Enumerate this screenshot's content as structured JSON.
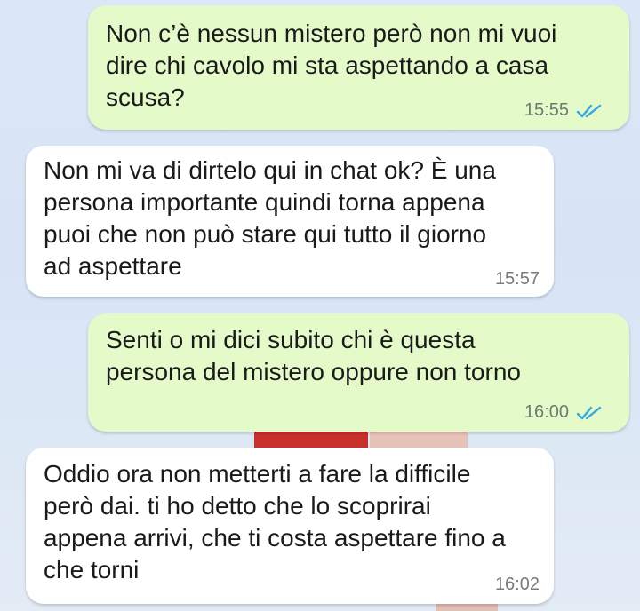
{
  "colors": {
    "outgoing_bubble": "#e4fbc9",
    "incoming_bubble": "#ffffff",
    "read_ticks": "#34a7e0",
    "wallpaper": "#d6e4f5"
  },
  "messages": [
    {
      "direction": "outgoing",
      "text": "Non c’è nessun mistero però non mi vuoi\ndire chi cavolo mi sta aspettando a casa\nscusa?",
      "time": "15:55",
      "status_icon": "double-check-read-icon"
    },
    {
      "direction": "incoming",
      "text": "Non mi va di dirtelo qui in chat ok? È una\npersona importante quindi torna appena\npuoi che non può stare qui tutto il giorno\nad aspettare",
      "time": "15:57"
    },
    {
      "direction": "outgoing",
      "text": "Senti o mi dici subito chi è questa\npersona del mistero oppure non torno",
      "time": "16:00",
      "status_icon": "double-check-read-icon"
    },
    {
      "direction": "incoming",
      "text": "Oddio ora non metterti a fare la difficile\nperò dai. ti ho detto che lo scoprirai\nappena arrivi, che ti costa aspettare fino a\nche torni",
      "time": "16:02"
    }
  ]
}
